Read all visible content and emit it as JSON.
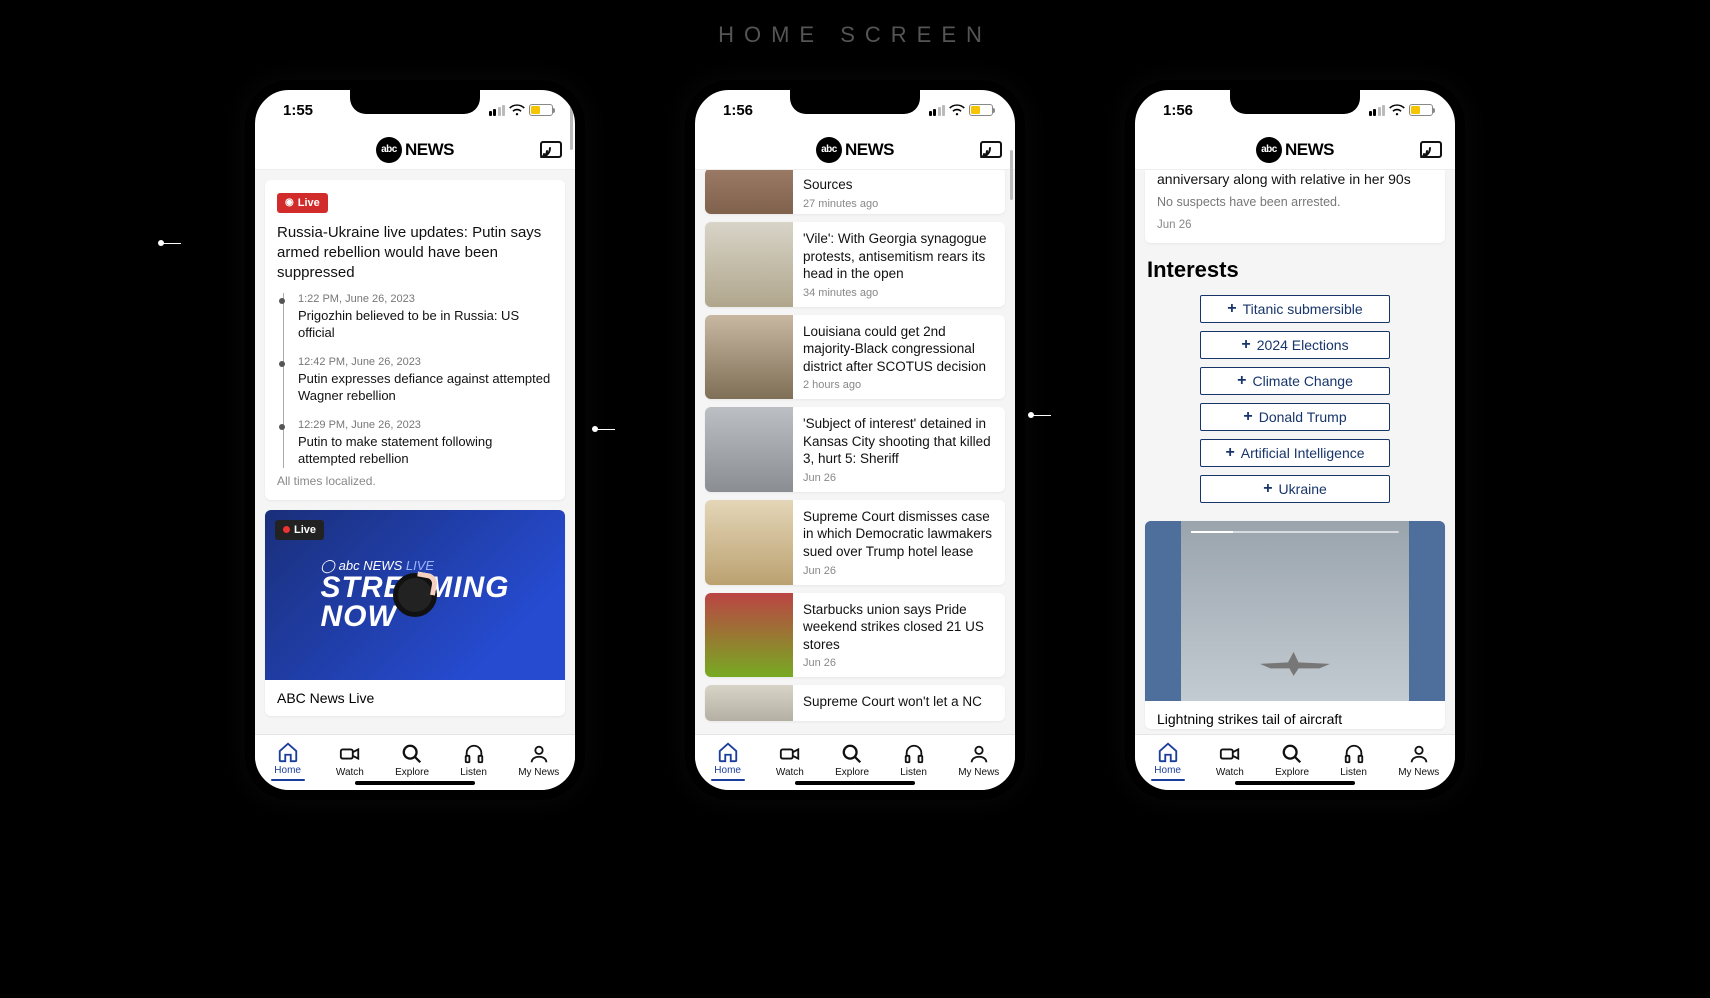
{
  "page_heading": "HOME SCREEN",
  "brand": {
    "circle": "abc",
    "word": "NEWS"
  },
  "tabs": {
    "home": "Home",
    "watch": "Watch",
    "explore": "Explore",
    "listen": "Listen",
    "mynews": "My News"
  },
  "phone1": {
    "time": "1:55",
    "live_label": "Live",
    "headline": "Russia-Ukraine live updates: Putin says armed rebellion would have been suppressed",
    "timeline": [
      {
        "time": "1:22 PM, June 26, 2023",
        "text": "Prigozhin believed to be in Russia: US official"
      },
      {
        "time": "12:42 PM, June 26, 2023",
        "text": "Putin expresses defiance against attempted Wagner rebellion"
      },
      {
        "time": "12:29 PM, June 26, 2023",
        "text": "Putin to make statement following attempted rebellion"
      }
    ],
    "local_note": "All times localized.",
    "video": {
      "pill": "Live",
      "brand_prefix": "abc NEWS",
      "brand_suffix": "LIVE",
      "line1": "STREAMING",
      "line2": "NOW",
      "caption": "ABC News Live"
    }
  },
  "phone2": {
    "time": "1:56",
    "items": [
      {
        "title": "Sources",
        "time": "27 minutes ago"
      },
      {
        "title": "'Vile': With Georgia synagogue protests, antisemitism rears its head in the open",
        "time": "34 minutes ago"
      },
      {
        "title": "Louisiana could get 2nd majority-Black congressional district after SCOTUS decision",
        "time": "2 hours ago"
      },
      {
        "title": "'Subject of interest' detained in Kansas City shooting that killed 3, hurt 5: Sheriff",
        "time": "Jun 26"
      },
      {
        "title": "Supreme Court dismisses case in which Democratic lawmakers sued over Trump hotel lease",
        "time": "Jun 26"
      },
      {
        "title": "Starbucks union says Pride weekend strikes closed 21 US stores",
        "time": "Jun 26"
      },
      {
        "title": "Supreme Court won't let a NC",
        "time": ""
      }
    ]
  },
  "phone3": {
    "time": "1:56",
    "prev": {
      "title": "anniversary along with relative in her 90s",
      "sub": "No suspects have been arrested.",
      "date": "Jun 26"
    },
    "interests_heading": "Interests",
    "chips": [
      "Titanic submersible",
      "2024 Elections",
      "Climate Change",
      "Donald Trump",
      "Artificial Intelligence",
      "Ukraine"
    ],
    "video_title": "Lightning strikes tail of aircraft"
  }
}
